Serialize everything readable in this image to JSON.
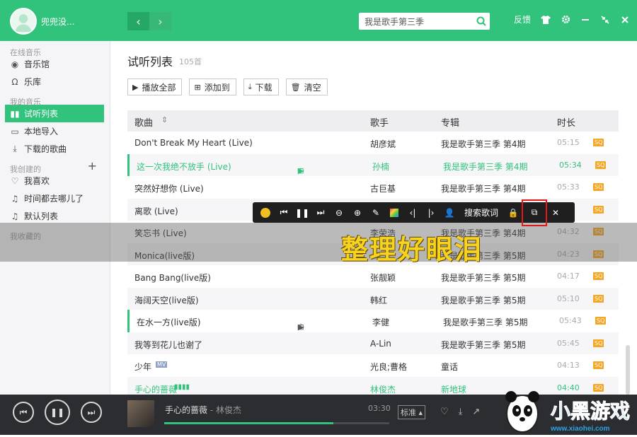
{
  "header": {
    "username": "兜兜没...",
    "back": "‹",
    "forward": "›",
    "search_value": "我是歌手第三季",
    "feedback": "反馈",
    "icons": [
      "tshirt-icon",
      "gear-icon",
      "minimize-icon",
      "shrink-icon",
      "close-icon"
    ]
  },
  "sidebar": {
    "section_online": "在线音乐",
    "music_hall": "音乐馆",
    "library": "乐库",
    "section_mine": "我的音乐",
    "trial_list": "试听列表",
    "local_import": "本地导入",
    "downloaded": "下载的歌曲",
    "section_created": "我创建的",
    "favorites": "我喜欢",
    "where_time": "时间都去哪儿了",
    "default_list": "默认列表",
    "section_collected": "我收藏的"
  },
  "main": {
    "title": "试听列表",
    "count": "105首",
    "actions": {
      "play_all": "播放全部",
      "add_to": "添加到",
      "download": "下载",
      "clear": "清空"
    },
    "columns": {
      "song": "歌曲",
      "artist": "歌手",
      "album": "专辑",
      "duration": "时长"
    },
    "rows": [
      {
        "song": "Don't Break My Heart (Live)",
        "artist": "胡彦斌",
        "album": "我是歌手第三季 第4期",
        "duration": "05:15",
        "quality": "SQ"
      },
      {
        "song": "这一次我绝不放手 (Live)",
        "artist": "孙楠",
        "album": "我是歌手第三季 第4期",
        "duration": "05:34",
        "quality": "SQ"
      },
      {
        "song": "突然好想你 (Live)",
        "artist": "古巨基",
        "album": "我是歌手第三季 第4期",
        "duration": "05:33",
        "quality": "SQ"
      },
      {
        "song": "离歌 (Live)",
        "artist": "",
        "album": "",
        "duration": "",
        "quality": "SQ"
      },
      {
        "song": "笑忘书 (Live)",
        "artist": "李荣浩",
        "album": "我是歌手第三季 第4期",
        "duration": "04:32",
        "quality": "SQ"
      },
      {
        "song": "Monica(live版)",
        "artist": "",
        "album": "我是歌手第三季 第5期",
        "duration": "04:23",
        "quality": "SQ"
      },
      {
        "song": "Bang Bang(live版)",
        "artist": "张靓颖",
        "album": "我是歌手第三季 第5期",
        "duration": "04:17",
        "quality": "SQ"
      },
      {
        "song": "海阔天空(live版)",
        "artist": "韩红",
        "album": "我是歌手第三季 第5期",
        "duration": "05:10",
        "quality": "SQ"
      },
      {
        "song": "在水一方(live版)",
        "artist": "李健",
        "album": "我是歌手第三季 第5期",
        "duration": "05:43",
        "quality": "SQ"
      },
      {
        "song": "我等到花儿也谢了",
        "artist": "A-Lin",
        "album": "我是歌手第三季 第5期",
        "duration": "05:45",
        "quality": "SQ"
      },
      {
        "song": "少年",
        "artist": "光良;曹格",
        "album": "童话",
        "duration": "04:13",
        "quality": "SQ",
        "mv": "MV"
      },
      {
        "song": "手心的蔷薇",
        "artist": "林俊杰",
        "album": "新地球",
        "duration": "04:40",
        "quality": "SQ"
      }
    ]
  },
  "lyric_toolbar": {
    "search_lyrics": "搜索歌词",
    "current_lyric": "整理好眼泪"
  },
  "player": {
    "track": "手心的蔷薇",
    "separator": " - ",
    "artist": "林俊杰",
    "time": "03:30",
    "quality": "标准",
    "progress": 0.75
  },
  "watermark": {
    "brand": "小黑游戏",
    "url": "www.xiaohei.com"
  },
  "colors": {
    "accent": "#31c27c",
    "sq_badge": "#f5a623",
    "lyric": "#f7d21e",
    "highlight_box": "#e01919"
  }
}
